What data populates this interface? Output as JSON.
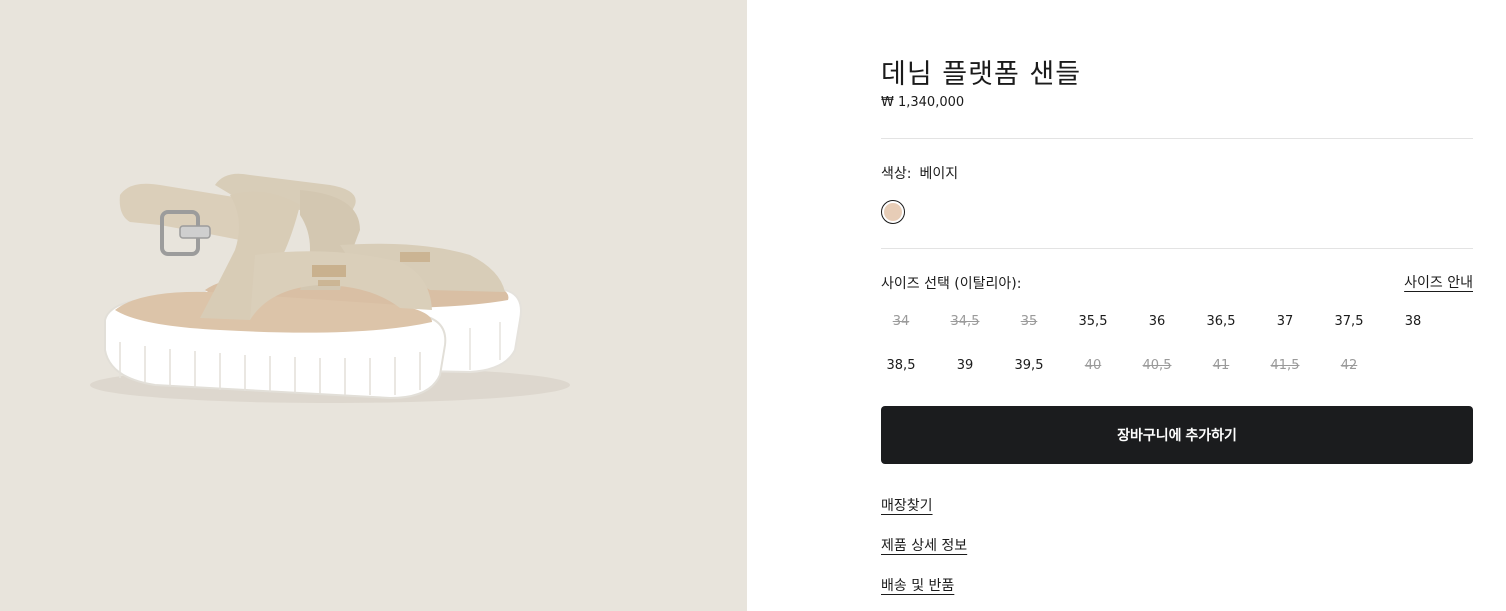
{
  "product": {
    "title": "데님 플랫폼 샌들",
    "price": "₩ 1,340,000",
    "image_alt": "sandal-product-image"
  },
  "color": {
    "label": "색상:",
    "value": "베이지",
    "swatch_color": "#e7cdb7"
  },
  "size": {
    "label": "사이즈 선택 (이탈리아):",
    "guide_label": "사이즈 안내",
    "options": [
      {
        "label": "34",
        "available": false
      },
      {
        "label": "34,5",
        "available": false
      },
      {
        "label": "35",
        "available": false
      },
      {
        "label": "35,5",
        "available": true
      },
      {
        "label": "36",
        "available": true
      },
      {
        "label": "36,5",
        "available": true
      },
      {
        "label": "37",
        "available": true
      },
      {
        "label": "37,5",
        "available": true
      },
      {
        "label": "38",
        "available": true
      },
      {
        "label": "38,5",
        "available": true
      },
      {
        "label": "39",
        "available": true
      },
      {
        "label": "39,5",
        "available": true
      },
      {
        "label": "40",
        "available": false
      },
      {
        "label": "40,5",
        "available": false
      },
      {
        "label": "41",
        "available": false
      },
      {
        "label": "41,5",
        "available": false
      },
      {
        "label": "42",
        "available": false
      }
    ]
  },
  "actions": {
    "add_to_cart": "장바구니에 추가하기"
  },
  "links": {
    "store_finder": "매장찾기",
    "product_details": "제품 상세 정보",
    "shipping_returns": "배송 및 반품"
  },
  "colors": {
    "image_background": "#e8e4dc",
    "button_background": "#1b1c1e",
    "divider": "#e3e3e3"
  }
}
